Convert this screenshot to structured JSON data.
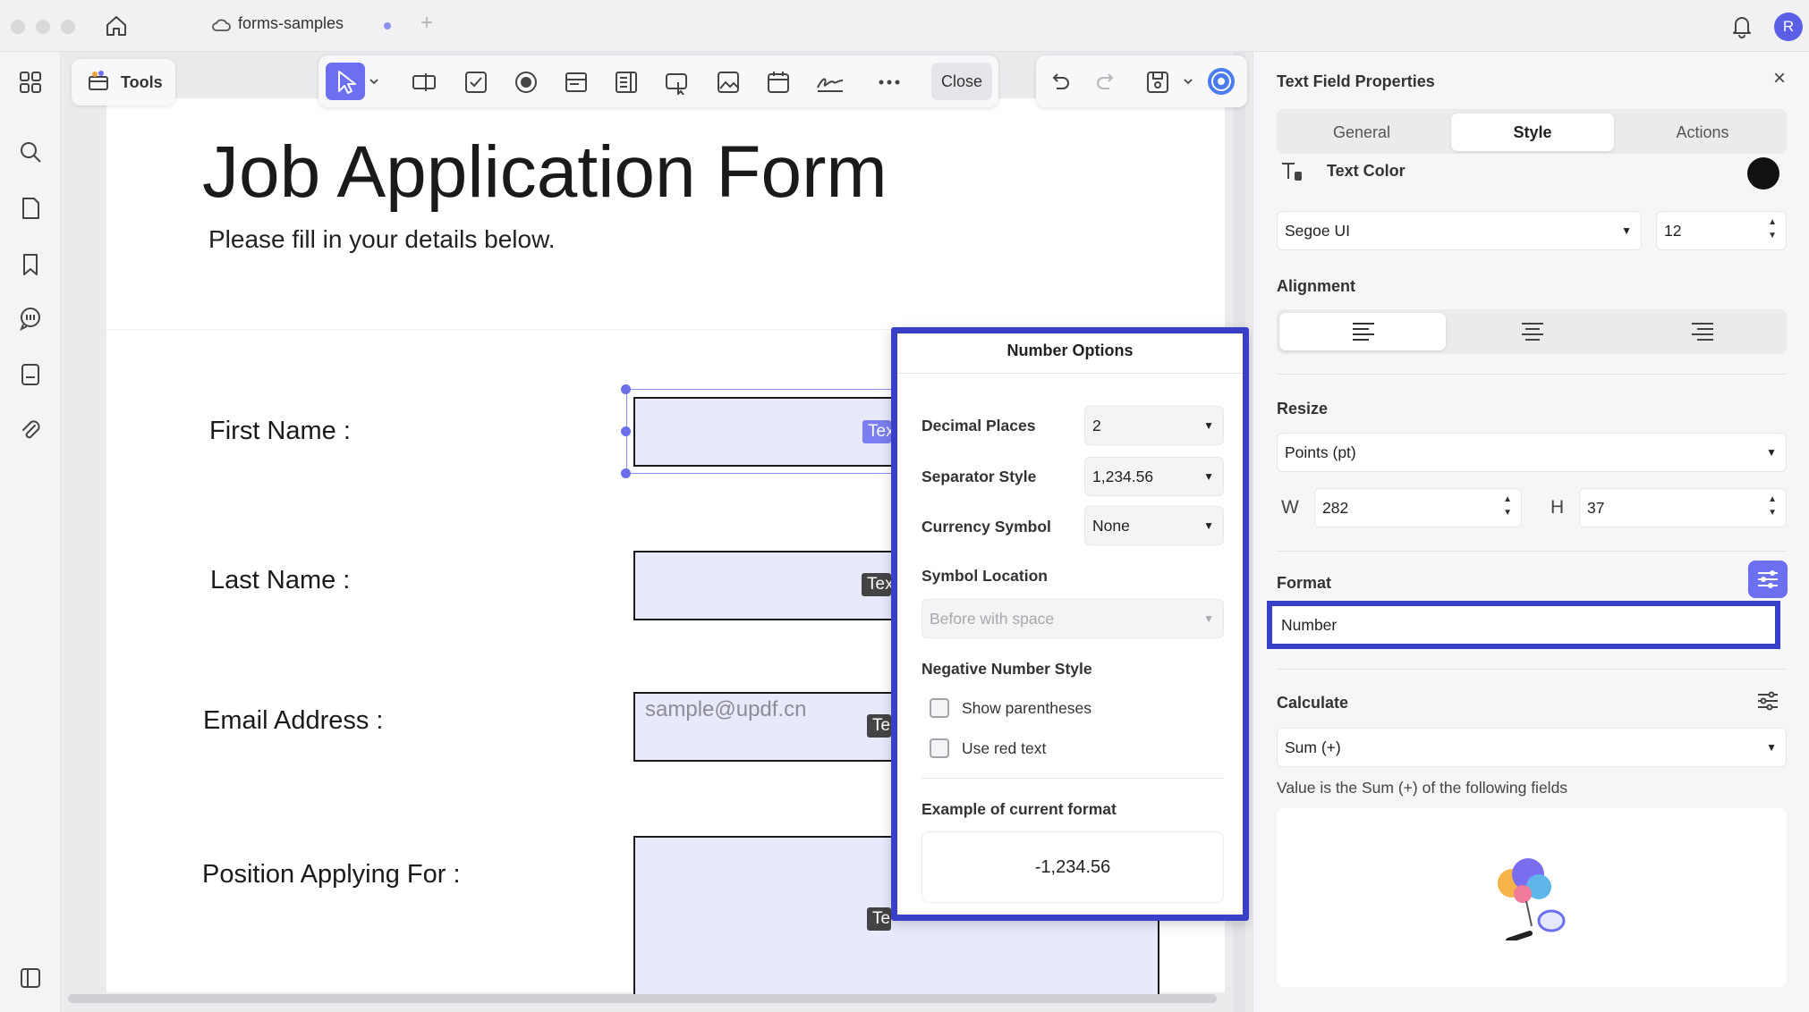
{
  "tab": {
    "title": "forms-samples",
    "add": "+"
  },
  "user": {
    "avatar_initial": "R"
  },
  "tools": {
    "label": "Tools"
  },
  "toolbar": {
    "close_label": "Close"
  },
  "document": {
    "title": "Job Application Form",
    "subtitle": "Please fill in your details below.",
    "fields": [
      {
        "label": "First Name :",
        "tag": "Tex"
      },
      {
        "label": "Last Name :",
        "tag": "Tex"
      },
      {
        "label": "Email Address :",
        "tag": "Te",
        "placeholder": "sample@updf.cn"
      },
      {
        "label": "Position Applying For :",
        "tag": "Te"
      }
    ]
  },
  "number_options": {
    "title": "Number Options",
    "decimal_places": {
      "label": "Decimal Places",
      "value": "2"
    },
    "separator_style": {
      "label": "Separator Style",
      "value": "1,234.56"
    },
    "currency_symbol": {
      "label": "Currency Symbol",
      "value": "None"
    },
    "symbol_location": {
      "label": "Symbol Location",
      "value": "Before with space"
    },
    "negative_style": {
      "label": "Negative Number Style",
      "show_parentheses": "Show parentheses",
      "use_red_text": "Use red text"
    },
    "example": {
      "label": "Example of current format",
      "value": "-1,234.56"
    }
  },
  "properties": {
    "title": "Text Field Properties",
    "close": "×",
    "tabs": [
      "General",
      "Style",
      "Actions"
    ],
    "active_tab": "Style",
    "text_color": {
      "label": "Text Color",
      "value": "#111111"
    },
    "font": {
      "family": "Segoe UI",
      "size": "12"
    },
    "alignment": {
      "label": "Alignment",
      "selected": "left"
    },
    "resize": {
      "label": "Resize",
      "unit": "Points (pt)",
      "w_label": "W",
      "w_value": "282",
      "h_label": "H",
      "h_value": "37"
    },
    "format": {
      "label": "Format",
      "value": "Number"
    },
    "calculate": {
      "label": "Calculate",
      "value": "Sum (+)",
      "note": "Value is the Sum (+) of the following fields"
    }
  },
  "colors": {
    "accent": "#6b6ff0",
    "highlight_border": "#3a3fc8",
    "field_fill": "#e8eafc"
  }
}
